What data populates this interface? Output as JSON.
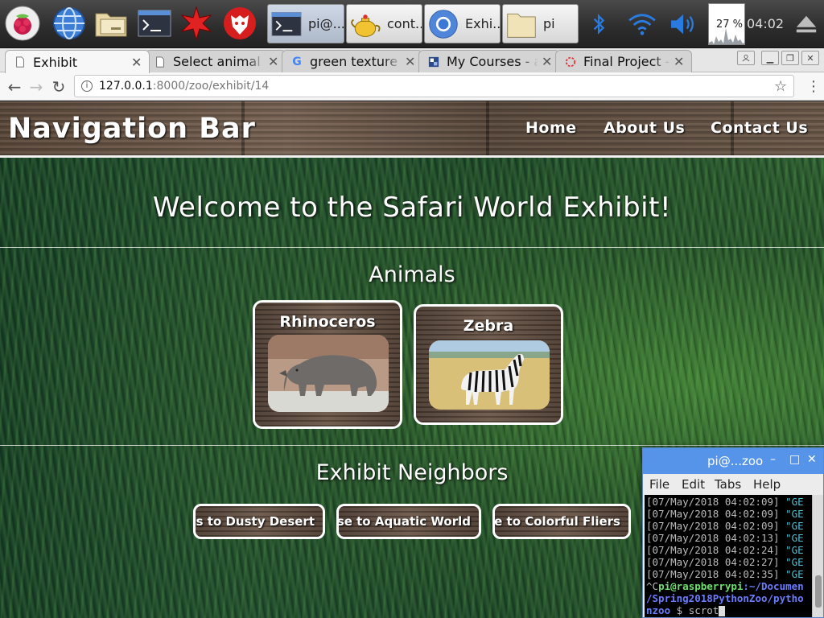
{
  "taskbar": {
    "tasks": [
      {
        "label": "pi@..."
      },
      {
        "label": "cont..."
      },
      {
        "label": "Exhi..."
      },
      {
        "label": "pi"
      }
    ],
    "cpu": "27 %",
    "clock": "04:02"
  },
  "browser": {
    "tabs": [
      {
        "title": "Exhibit"
      },
      {
        "title": "Select animal to"
      },
      {
        "title": "green texture - Go"
      },
      {
        "title": "My Courses - all"
      },
      {
        "title": "Final Project - D"
      }
    ],
    "url": {
      "host": "127.0.0.1",
      "rest": ":8000/zoo/exhibit/14"
    }
  },
  "page": {
    "brand": "Navigation Bar",
    "nav": [
      "Home",
      "About Us",
      "Contact Us"
    ],
    "welcome": "Welcome to the Safari World Exhibit!",
    "animals_heading": "Animals",
    "animals": [
      {
        "name": "Rhinoceros"
      },
      {
        "name": "Zebra"
      }
    ],
    "neighbors_heading": "Exhibit Neighbors",
    "neighbors": [
      "s to Dusty Desert",
      "se to Aquatic World",
      "e to Colorful Fliers"
    ]
  },
  "terminal": {
    "title": "pi@...zoo",
    "menu": [
      "File",
      "Edit",
      "Tabs",
      "Help"
    ],
    "log_lines": [
      {
        "time": "[07/May/2018 04:02:09]",
        "req": "\"GE"
      },
      {
        "time": "[07/May/2018 04:02:09]",
        "req": "\"GE"
      },
      {
        "time": "[07/May/2018 04:02:09]",
        "req": "\"GE"
      },
      {
        "time": "[07/May/2018 04:02:13]",
        "req": "\"GE"
      },
      {
        "time": "[07/May/2018 04:02:24]",
        "req": "\"GE"
      },
      {
        "time": "[07/May/2018 04:02:27]",
        "req": "\"GE"
      },
      {
        "time": "[07/May/2018 04:02:35]",
        "req": "\"GE"
      }
    ],
    "prompt_prefix": "^C",
    "prompt_user": "pi@raspberrypi",
    "prompt_path_1": ":~/Documen",
    "prompt_path_2": "/Spring2018PythonZoo/pytho",
    "prompt_path_3": "nzoo",
    "prompt_symbol": " $ ",
    "command": "scrot"
  }
}
